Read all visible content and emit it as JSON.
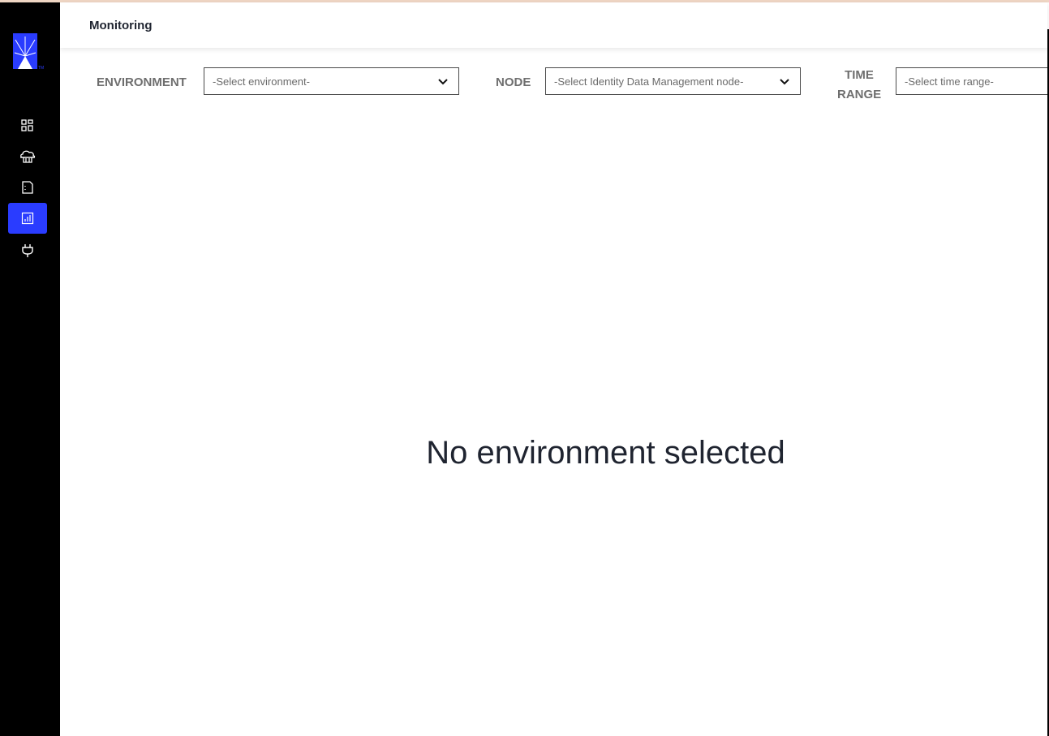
{
  "header": {
    "title": "Monitoring"
  },
  "sidebar": {
    "logo": "product-logo",
    "items": [
      {
        "icon": "dashboard-icon",
        "active": false
      },
      {
        "icon": "cloud-icon",
        "active": false
      },
      {
        "icon": "document-icon",
        "active": false
      },
      {
        "icon": "bar-chart-icon",
        "active": true
      },
      {
        "icon": "plug-icon",
        "active": false
      }
    ],
    "active_color": "#2a3cff"
  },
  "filters": {
    "environment": {
      "label": "ENVIRONMENT",
      "value": "-Select environment-"
    },
    "node": {
      "label": "NODE",
      "value": "-Select Identity Data Management node-"
    },
    "time_range": {
      "label_line1": "TIME",
      "label_line2": "RANGE",
      "value": "-Select time range-"
    }
  },
  "main": {
    "empty_message": "No environment selected"
  }
}
